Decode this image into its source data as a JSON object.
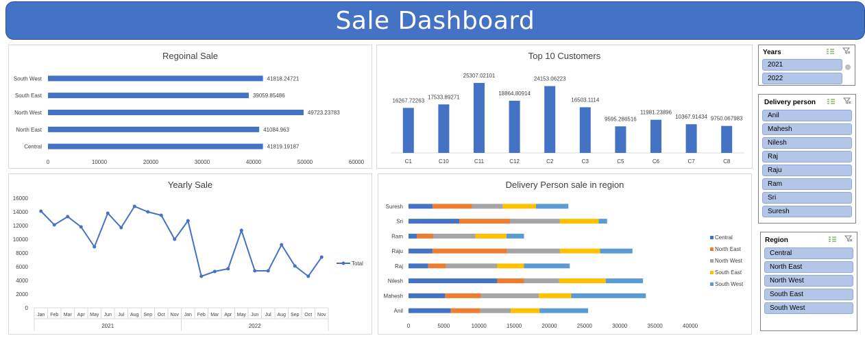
{
  "header": {
    "title": "Sale Dashboard"
  },
  "regional_chart": {
    "title": "Regoinal Sale",
    "chart_data": {
      "type": "bar",
      "orientation": "horizontal",
      "title": "Regoinal Sale",
      "categories": [
        "Central",
        "North East",
        "North West",
        "South East",
        "South West"
      ],
      "values": [
        41819.19187,
        41084.963,
        49723.23783,
        39059.85486,
        41818.24721
      ],
      "value_labels": [
        "41819.19187",
        "41084.963",
        "49723.23783",
        "39059.85486",
        "41818.24721"
      ],
      "xlim": [
        0,
        60000
      ],
      "ticks": [
        "0",
        "10000",
        "20000",
        "30000",
        "40000",
        "50000",
        "60000"
      ],
      "color": "#4472c4",
      "grid": false
    }
  },
  "customers_chart": {
    "title": "Top 10 Customers",
    "chart_data": {
      "type": "bar",
      "title": "Top 10 Customers",
      "categories": [
        "C1",
        "C10",
        "C11",
        "C12",
        "C2",
        "C3",
        "C5",
        "C6",
        "C7",
        "C8"
      ],
      "values": [
        16267.72263,
        17533.89271,
        25307.02101,
        18864.80914,
        24153.06223,
        16503.1114,
        9595.286516,
        11981.23896,
        10367.91434,
        9750.067983
      ],
      "value_labels": [
        "16267.72263",
        "17533.89271",
        "25307.02101",
        "18864.80914",
        "24153.06223",
        "16503.1114",
        "9595.286516",
        "11981.23896",
        "10367.91434",
        "9750.067983"
      ],
      "ylim": [
        0,
        30000
      ],
      "color": "#4472c4",
      "grid": false
    }
  },
  "yearly_chart": {
    "title": "Yearly Sale",
    "chart_data": {
      "type": "line",
      "title": "Yearly Sale",
      "months": [
        "Jan",
        "Feb",
        "Mar",
        "Apr",
        "May",
        "Jun",
        "Jul",
        "Aug",
        "Sep",
        "Oct",
        "Nov",
        "Jan",
        "Feb",
        "Mar",
        "Apr",
        "May",
        "Jun",
        "Jul",
        "Aug",
        "Sep",
        "Oct",
        "Nov"
      ],
      "years": [
        {
          "label": "2021",
          "count": 11
        },
        {
          "label": "2022",
          "count": 11
        }
      ],
      "series": [
        {
          "name": "Total",
          "values": [
            14100,
            12100,
            13300,
            11800,
            8900,
            13800,
            11700,
            14800,
            14000,
            13500,
            10000,
            12700,
            4600,
            5300,
            5700,
            11300,
            5400,
            5400,
            9200,
            6100,
            4600,
            7400
          ]
        }
      ],
      "ylim": [
        0,
        16000
      ],
      "ticks": [
        "0",
        "2000",
        "4000",
        "6000",
        "8000",
        "10000",
        "12000",
        "14000",
        "16000"
      ],
      "color": "#4472c4",
      "legend": "right",
      "grid": false
    }
  },
  "delivery_chart": {
    "title": "Delivery Person sale in region",
    "chart_data": {
      "type": "bar",
      "stacked": true,
      "orientation": "horizontal",
      "title": "Delivery Person sale in region",
      "categories": [
        "Anil",
        "Mahesh",
        "Nilesh",
        "Raj",
        "Raju",
        "Ram",
        "Sri",
        "Suresh"
      ],
      "series": [
        {
          "name": "Central",
          "color": "#4472c4",
          "values": [
            6000,
            5200,
            12600,
            2800,
            3400,
            1200,
            7200,
            3400
          ]
        },
        {
          "name": "North East",
          "color": "#ed7d31",
          "values": [
            4200,
            5100,
            3800,
            2500,
            10600,
            2300,
            7200,
            5600
          ]
        },
        {
          "name": "North West",
          "color": "#a5a5a5",
          "values": [
            4300,
            8200,
            5000,
            7300,
            7500,
            6000,
            7100,
            4400
          ]
        },
        {
          "name": "South East",
          "color": "#ffc000",
          "values": [
            4100,
            4600,
            6600,
            3800,
            5700,
            4400,
            5500,
            4700
          ]
        },
        {
          "name": "South West",
          "color": "#5b9bd5",
          "values": [
            6900,
            10600,
            5300,
            6500,
            4600,
            2500,
            1200,
            4600
          ]
        }
      ],
      "xlim": [
        0,
        40000
      ],
      "ticks": [
        "0",
        "5000",
        "10000",
        "15000",
        "20000",
        "25000",
        "30000",
        "35000",
        "40000"
      ],
      "legend": "right",
      "grid": false
    }
  },
  "slicers": {
    "years": {
      "title": "Years",
      "items": [
        "2021",
        "2022"
      ]
    },
    "delivery": {
      "title": "Delivery person",
      "items": [
        "Anil",
        "Mahesh",
        "Nilesh",
        "Raj",
        "Raju",
        "Ram",
        "Sri",
        "Suresh"
      ]
    },
    "region": {
      "title": "Region",
      "items": [
        "Central",
        "North East",
        "North West",
        "South East",
        "South West"
      ]
    }
  }
}
